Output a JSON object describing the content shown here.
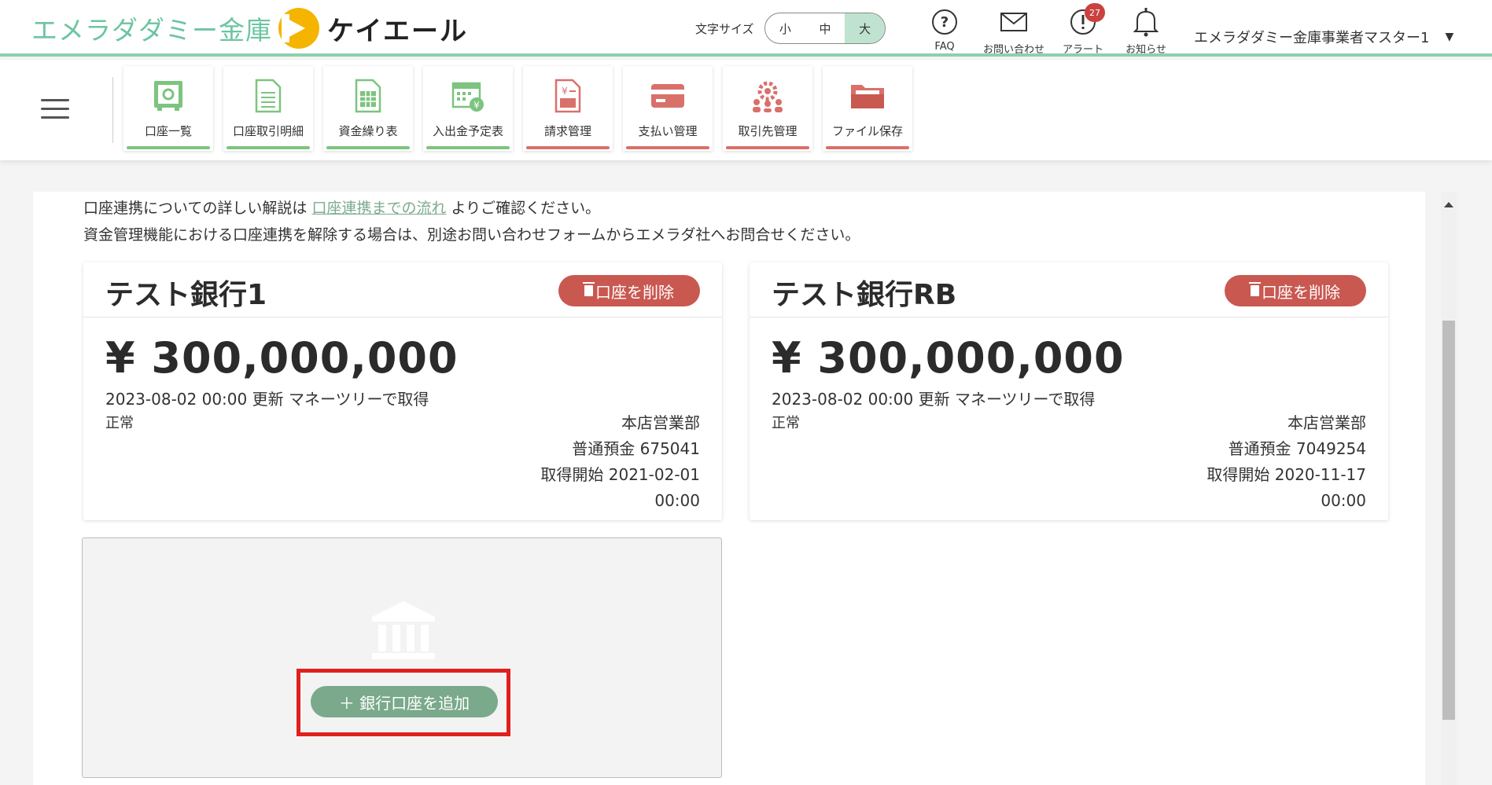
{
  "brand": {
    "name": "エメラダダミー金庫",
    "sub": "ケイエール"
  },
  "header": {
    "font_size_label": "文字サイズ",
    "font_sizes": [
      "小",
      "中",
      "大"
    ],
    "nav": {
      "faq": "FAQ",
      "contact": "お問い合わせ",
      "alert": "アラート",
      "alert_count": "27",
      "notice": "お知らせ"
    },
    "user_name": "エメラダダミー金庫事業者マスター1",
    "caret": "▼"
  },
  "toolbar": {
    "items": [
      {
        "label": "口座一覧"
      },
      {
        "label": "口座取引明細"
      },
      {
        "label": "資金繰り表"
      },
      {
        "label": "入出金予定表"
      },
      {
        "label": "請求管理"
      },
      {
        "label": "支払い管理"
      },
      {
        "label": "取引先管理"
      },
      {
        "label": "ファイル保存"
      }
    ]
  },
  "info": {
    "line1_pre": "口座連携についての詳しい解説は",
    "line1_link": "口座連携までの流れ",
    "line1_post": "よりご確認ください。",
    "line2": "資金管理機能における口座連携を解除する場合は、別途お問い合わせフォームからエメラダ社へお問合せください。"
  },
  "accounts": [
    {
      "bank": "テスト銀行1",
      "delete": "口座を削除",
      "balance": "¥ 300,000,000",
      "updated": "2023-08-02 00:00 更新 マネーツリーで取得",
      "status": "正常",
      "branch": "本店営業部",
      "account": "普通預金 675041",
      "start": "取得開始 2021-02-01",
      "start_time": "00:00"
    },
    {
      "bank": "テスト銀行RB",
      "delete": "口座を削除",
      "balance": "¥ 300,000,000",
      "updated": "2023-08-02 00:00 更新 マネーツリーで取得",
      "status": "正常",
      "branch": "本店営業部",
      "account": "普通預金 7049254",
      "start": "取得開始 2020-11-17",
      "start_time": "00:00"
    }
  ],
  "add_account": {
    "label": "＋ 銀行口座を追加"
  },
  "colors": {
    "brand_green": "#6cc5a2",
    "tile_green": "#7cc47f",
    "tile_red": "#d9706a",
    "delete_red": "#c95851",
    "add_green": "#7aa98b",
    "highlight": "#e0201d"
  }
}
